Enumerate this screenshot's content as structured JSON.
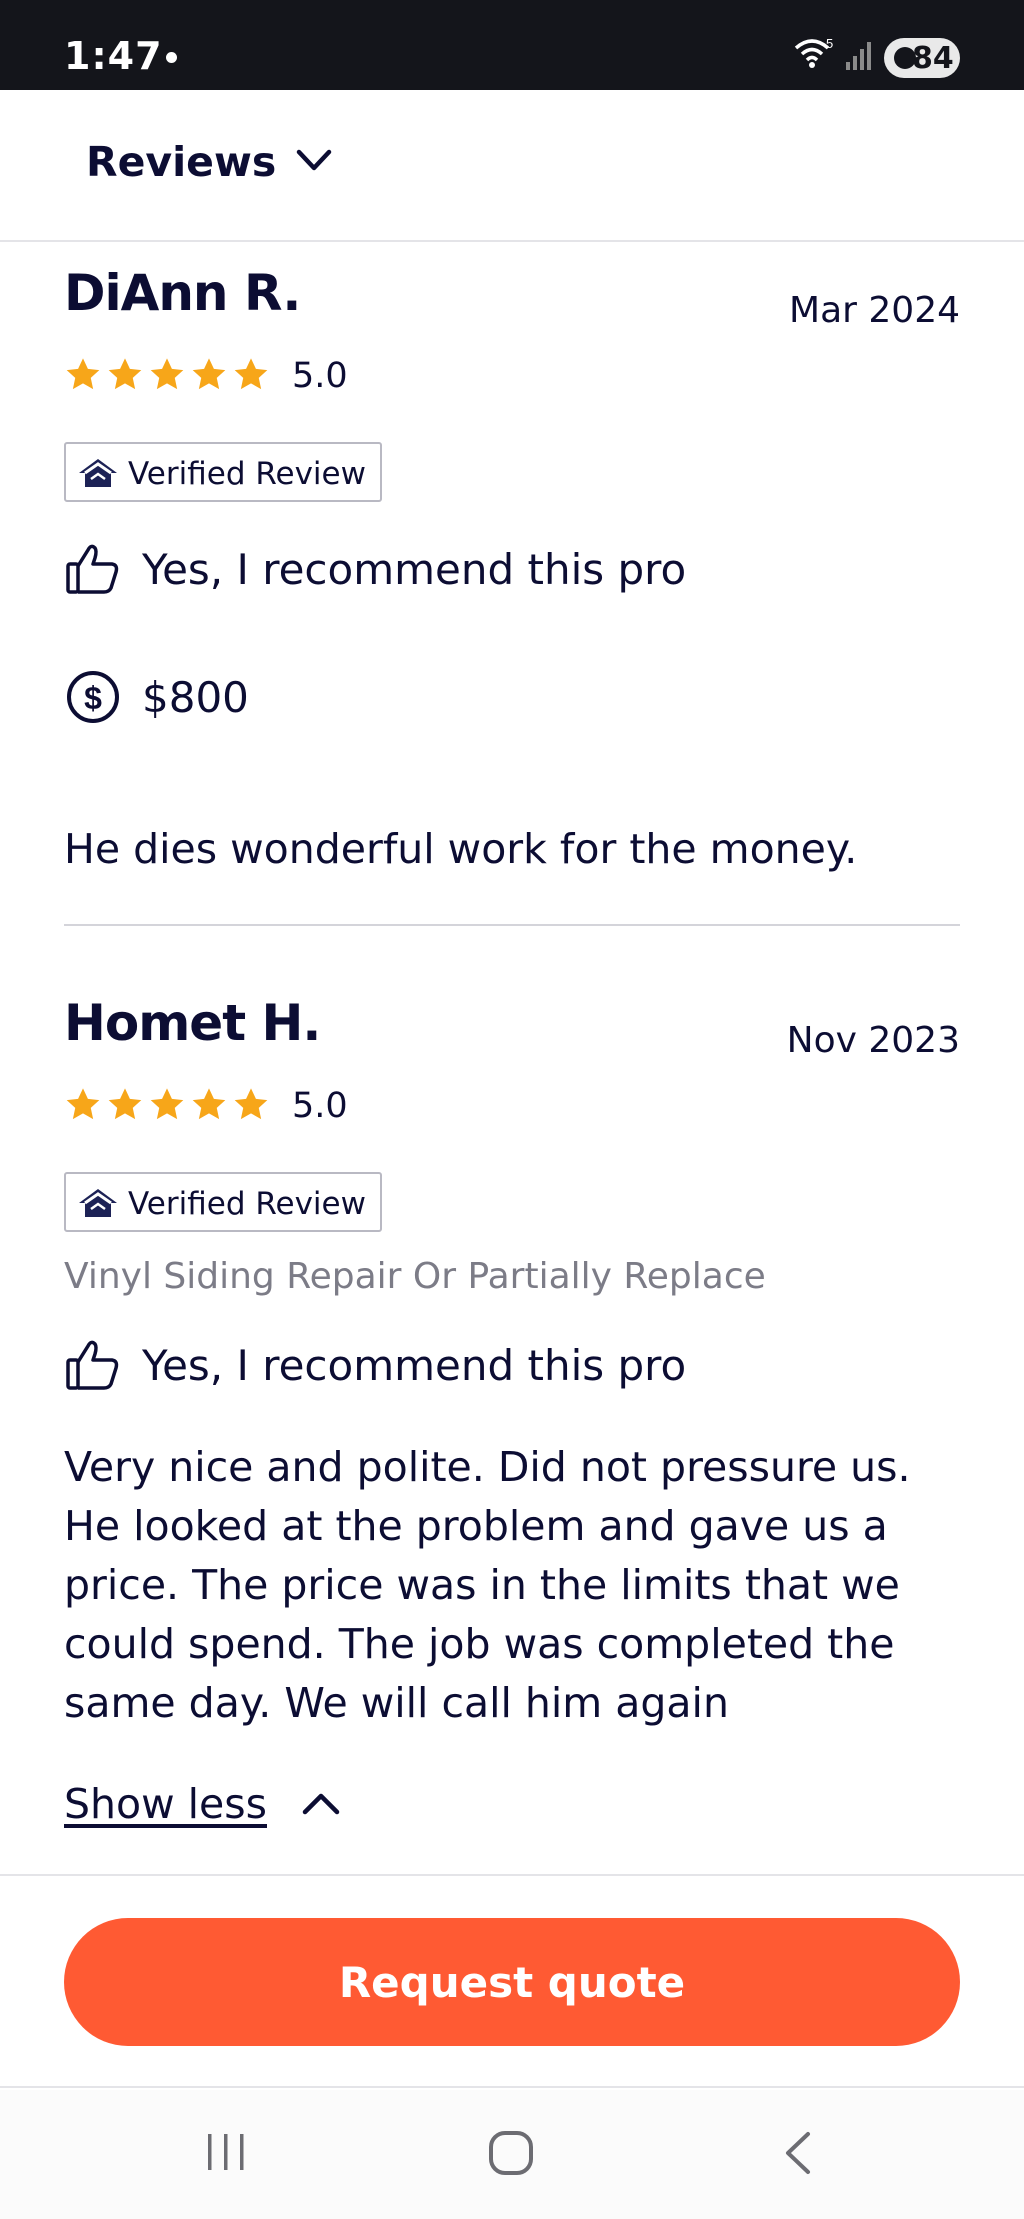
{
  "status_bar": {
    "time": "1:47",
    "wifi_label": "5",
    "battery": "84"
  },
  "header": {
    "title": "Reviews"
  },
  "reviews": [
    {
      "name": "DiAnn R.",
      "date": "Mar 2024",
      "rating": "5.0",
      "stars": 5,
      "badge": "Verified Review",
      "recommend": "Yes, I recommend this pro",
      "cost": "$800",
      "text": "He dies wonderful work for the money."
    },
    {
      "name": "Homet H.",
      "date": "Nov 2023",
      "rating": "5.0",
      "stars": 5,
      "badge": "Verified Review",
      "service": "Vinyl Siding Repair Or Partially Replace",
      "recommend": "Yes, I recommend this pro",
      "text": "Very nice and polite. Did not pressure us. He looked at the problem and gave us a price. The price was in the limits that we could spend. The job was completed the same day. We will call him again"
    }
  ],
  "show_less": "Show less",
  "cta": {
    "label": "Request quote"
  },
  "colors": {
    "accent": "#ff5a33",
    "star": "#f7a619",
    "text": "#0c0d33",
    "muted": "#7c7c87"
  }
}
